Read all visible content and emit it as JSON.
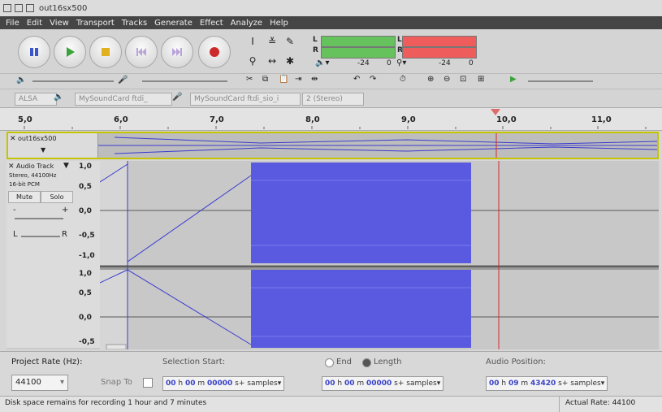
{
  "window": {
    "title": "out16sx500"
  },
  "menu": [
    "File",
    "Edit",
    "View",
    "Transport",
    "Tracks",
    "Generate",
    "Effect",
    "Analyze",
    "Help"
  ],
  "meters": {
    "left_label": "L",
    "right_label": "R",
    "left_db": "-24",
    "zero": "0",
    "right_db": "-24",
    "right_zero": "0"
  },
  "device": {
    "host": "ALSA",
    "playback": "MySoundCard ftdi_",
    "recording": "MySoundCard ftdi_sio_i",
    "channels": "2 (Stereo)"
  },
  "ruler": {
    "ticks": [
      "5,0",
      "6,0",
      "7,0",
      "8,0",
      "9,0",
      "10,0",
      "11,0"
    ]
  },
  "overview_track": {
    "name": "out16sx500"
  },
  "track": {
    "name": "Audio Track",
    "info1": "Stereo, 44100Hz",
    "info2": "16-bit PCM",
    "mute": "Mute",
    "solo": "Solo",
    "gain_minus": "-",
    "gain_plus": "+",
    "pan_left": "L",
    "pan_right": "R"
  },
  "yaxis_top": [
    "1,0",
    "0,5",
    "0,0",
    "-0,5",
    "-1,0"
  ],
  "yaxis_bottom": [
    "1,0",
    "0,5",
    "0,0",
    "-0,5"
  ],
  "bottom": {
    "project_rate_label": "Project Rate (Hz):",
    "project_rate": "44100",
    "snap_label": "Snap To",
    "selection_start_label": "Selection Start:",
    "end_label": "End",
    "length_label": "Length",
    "audio_position_label": "Audio Position:",
    "sel_start": {
      "h": "00",
      "m": "00",
      "s": "00000",
      "unit": "samples"
    },
    "sel_len": {
      "h": "00",
      "m": "00",
      "s": "00000",
      "unit": "samples"
    },
    "audio_pos": {
      "h": "00",
      "m": "09",
      "s": "43420",
      "unit": "samples"
    }
  },
  "status": {
    "left": "Disk space remains for recording 1 hour and 7 minutes",
    "right": "Actual Rate: 44100"
  },
  "colors": {
    "waveform": "#5a5ae0",
    "selection_bg": "#c8c8c8",
    "cursor": "#d02a2a",
    "overview_border": "#c4c400"
  }
}
